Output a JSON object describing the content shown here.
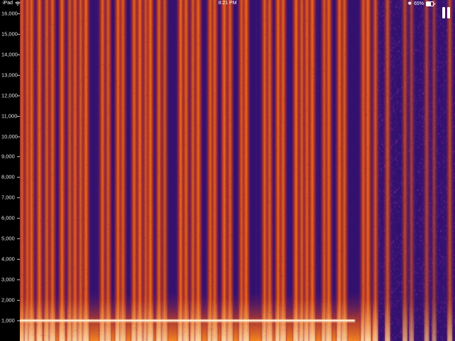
{
  "status_bar": {
    "device": "iPad",
    "time": "8:21 PM",
    "battery": "65%",
    "battery_level": 0.65
  },
  "y_axis": {
    "ticks": [
      "16,000",
      "15,000",
      "14,000",
      "13,000",
      "12,000",
      "11,000",
      "10,000",
      "9,000",
      "8,000",
      "7,000",
      "6,000",
      "5,000",
      "4,000",
      "3,000",
      "2,000",
      "1,000"
    ],
    "max_hz": 16650
  },
  "colors": {
    "background": "#2b0f6a",
    "low": "#4a1a7a",
    "mid": "#c2361e",
    "high": "#ff7a10",
    "peak": "#ffe0b0",
    "tone_line": "#fff6e6"
  },
  "spectrogram": {
    "tone_hz": 1000,
    "stripe_positions": [
      0.005,
      0.018,
      0.027,
      0.045,
      0.062,
      0.075,
      0.097,
      0.115,
      0.127,
      0.14,
      0.152,
      0.19,
      0.203,
      0.226,
      0.237,
      0.263,
      0.276,
      0.29,
      0.3,
      0.32,
      0.333,
      0.37,
      0.382,
      0.398,
      0.41,
      0.438,
      0.448,
      0.47,
      0.483,
      0.51,
      0.52,
      0.563,
      0.574,
      0.594,
      0.605,
      0.635,
      0.648,
      0.66,
      0.672,
      0.7,
      0.71,
      0.735,
      0.746,
      0.79,
      0.8,
      0.817,
      0.845,
      0.885,
      0.9,
      0.935,
      0.952,
      0.988
    ],
    "stripe_strengths": [
      0.8,
      0.9,
      0.85,
      0.9,
      0.8,
      0.85,
      0.9,
      0.75,
      0.85,
      0.8,
      0.9,
      0.85,
      0.8,
      0.9,
      0.8,
      0.85,
      0.9,
      0.8,
      0.9,
      0.85,
      0.75,
      0.9,
      0.85,
      0.8,
      0.9,
      0.85,
      0.8,
      0.9,
      0.8,
      0.85,
      0.9,
      0.85,
      0.8,
      0.9,
      0.85,
      0.9,
      0.8,
      0.85,
      0.9,
      0.8,
      0.85,
      0.9,
      0.8,
      0.85,
      0.9,
      0.75,
      0.7,
      0.6,
      0.5,
      0.55,
      0.45,
      0.6
    ]
  },
  "controls": {
    "pause_icon": "pause-icon"
  }
}
